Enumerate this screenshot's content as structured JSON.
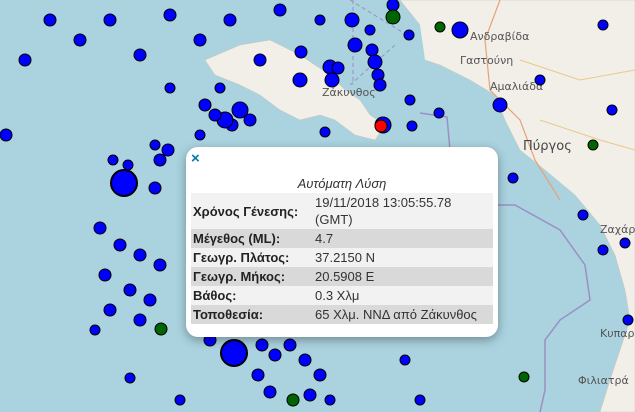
{
  "map": {
    "towns": [
      "Ανδραβίδα",
      "Γαστούνη",
      "Αμαλιάδα",
      "Ζάκυνθος",
      "Πύργος",
      "Ζαχάρω",
      "Κυπαρισσία",
      "Φιλιατρά"
    ],
    "colors": {
      "sea": "#aad3df",
      "land": "#f2efe9",
      "event_old": "#0000ff",
      "event_recent": "#006400",
      "event_selected": "#ff0000"
    }
  },
  "popup": {
    "close_icon": "×",
    "title": "Αυτόματη Λύση",
    "rows": [
      {
        "label": "Χρόνος Γένεσης:",
        "value": "19/11/2018 13:05:55.78 (GMT)"
      },
      {
        "label": "Μέγεθος (ML):",
        "value": "4.7"
      },
      {
        "label": "Γεωγρ. Πλάτος:",
        "value": "37.2150 N"
      },
      {
        "label": "Γεωγρ. Μήκος:",
        "value": "20.5908 E"
      },
      {
        "label": "Βάθος:",
        "value": "0.3 Χλμ"
      },
      {
        "label": "Τοποθεσία:",
        "value": "65 Χλμ. ΝΝΔ από Ζάκυνθος"
      }
    ]
  }
}
